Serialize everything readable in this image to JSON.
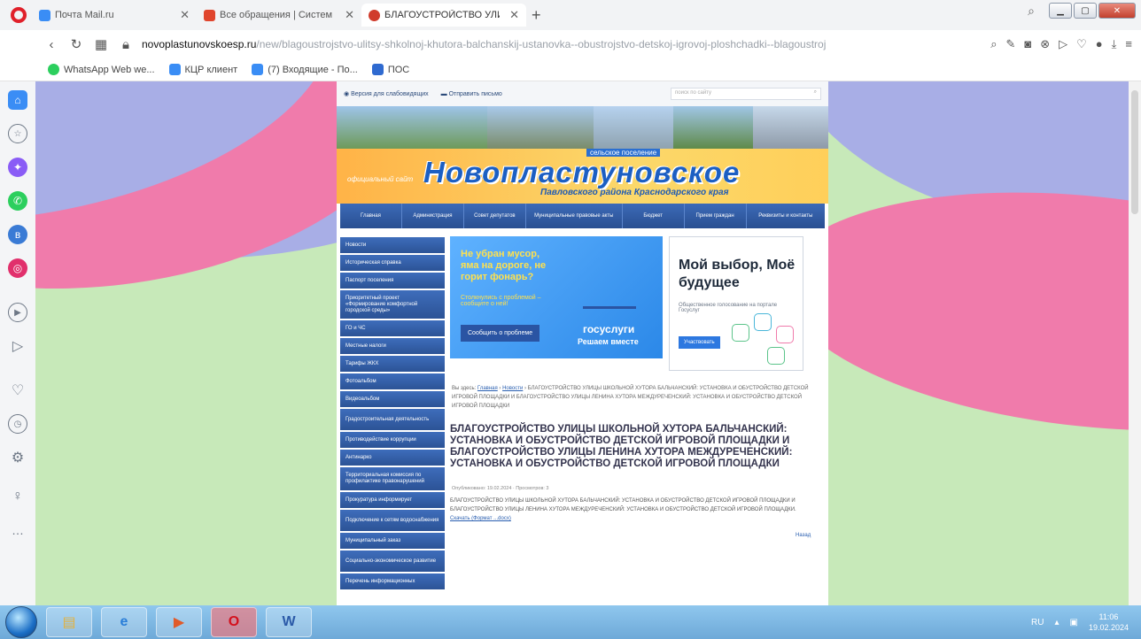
{
  "browser": {
    "tabs": [
      {
        "label": "Почта Mail.ru",
        "color": "#3a8df5",
        "active": false
      },
      {
        "label": "Все обращения | Систем",
        "color": "#e0452d",
        "active": false
      },
      {
        "label": "БЛАГОУСТРОЙСТВО УЛИ",
        "color": "#d03b2c",
        "active": true
      }
    ],
    "new_tab": "+",
    "url_host": "novoplastunovskoesp.ru",
    "url_path": "/new/blagoustrojstvo-ulitsy-shkolnoj-khutora-balchanskij-ustanovka--obustrojstvo-detskoj-igrovoj-ploshchadki--blagoustroj",
    "bookmarks": [
      {
        "label": "WhatsApp Web we...",
        "color": "#2ccf5e"
      },
      {
        "label": "КЦР клиент",
        "color": "#3a8df5"
      },
      {
        "label": "(7) Входящие - По...",
        "color": "#3a8df5"
      },
      {
        "label": "ПОС",
        "color": "#2f6ad0"
      }
    ]
  },
  "site": {
    "top_links": {
      "low_vision": "Версия для слабовидящих",
      "send_letter": "Отправить письмо",
      "search_placeholder": "поиск по сайту"
    },
    "banner": {
      "official": "официальный сайт",
      "settlement": "сельское поселение",
      "title": "Новопластуновское",
      "region": "Павловского района Краснодарского края"
    },
    "nav": [
      "Главная",
      "Администрация",
      "Совет депутатов",
      "Муниципальные правовые акты",
      "Бюджет",
      "Прием граждан",
      "Реквизиты и контакты"
    ],
    "left_menu": [
      "Новости",
      "Историческая справка",
      "Паспорт поселения",
      "Приоритетный проект «Формирование комфортной городской среды»",
      "ГО и ЧС",
      "Местные налоги",
      "Тарифы ЖКХ",
      "Фотоальбом",
      "Видеоальбом",
      "Градостроительная деятельность",
      "Противодействие коррупции",
      "Антинарко",
      "Территориальная комиссия по профилактике правонарушений",
      "Прокуратура информирует",
      "Подключение к сетям водоснабжения",
      "Муниципальный заказ",
      "Социально-экономическое развитие",
      "Перечень информационных"
    ],
    "promo_left": {
      "headline": "Не убран мусор, яма на дороге, не горит фонарь?",
      "sub": "Столкнулись с проблемой – сообщите о ней!",
      "button": "Сообщить о проблеме",
      "logo": "госуслуги",
      "slogan": "Решаем вместе"
    },
    "promo_right": {
      "headline": "Мой выбор, Моё будущее",
      "sub": "Общественное голосование на портале Госуслуг",
      "button": "Участвовать"
    },
    "breadcrumbs": {
      "prefix": "Вы здесь:",
      "home": "Главная",
      "news": "Новости",
      "current": "БЛАГОУСТРОЙСТВО УЛИЦЫ ШКОЛЬНОЙ ХУТОРА БАЛЬЧАНСКИЙ: УСТАНОВКА И ОБУСТРОЙСТВО ДЕТСКОЙ ИГРОВОЙ ПЛОЩАДКИ И БЛАГОУСТРОЙСТВО УЛИЦЫ ЛЕНИНА ХУТОРА МЕЖДУРЕЧЕНСКИЙ: УСТАНОВКА И ОБУСТРОЙСТВО ДЕТСКОЙ ИГРОВОЙ ПЛОЩАДКИ"
    },
    "article": {
      "title": "БЛАГОУСТРОЙСТВО УЛИЦЫ ШКОЛЬНОЙ ХУТОРА БАЛЬЧАНСКИЙ: УСТАНОВКА И ОБУСТРОЙСТВО ДЕТСКОЙ ИГРОВОЙ ПЛОЩАДКИ И БЛАГОУСТРОЙСТВО УЛИЦЫ ЛЕНИНА ХУТОРА МЕЖДУРЕЧЕНСКИЙ: УСТАНОВКА И ОБУСТРОЙСТВО ДЕТСКОЙ ИГРОВОЙ ПЛОЩАДКИ",
      "meta": "Опубликовано: 19.02.2024 · Просмотров: 3",
      "body": "БЛАГОУСТРОЙСТВО УЛИЦЫ ШКОЛЬНОЙ ХУТОРА БАЛЬЧАНСКИЙ: УСТАНОВКА И ОБУСТРОЙСТВО ДЕТСКОЙ ИГРОВОЙ ПЛОЩАДКИ И БЛАГОУСТРОЙСТВО УЛИЦЫ ЛЕНИНА ХУТОРА МЕЖДУРЕЧЕНСКИЙ: УСТАНОВКА И ОБУСТРОЙСТВО ДЕТСКОЙ ИГРОВОЙ ПЛОЩАДКИ.",
      "download": "Скачать (Формат ...docx)",
      "back": "Назад"
    }
  },
  "taskbar": {
    "lang": "RU",
    "time": "11:06",
    "date": "19.02.2024"
  }
}
